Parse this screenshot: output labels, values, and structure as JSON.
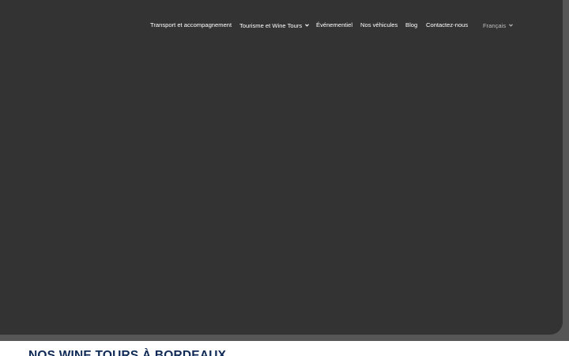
{
  "nav": {
    "items": [
      {
        "label": "Transport et accompagnement"
      },
      {
        "label": "Tourisme et Wine Tours"
      },
      {
        "label": "Événementiel"
      },
      {
        "label": "Nos véhicules"
      },
      {
        "label": "Blog"
      },
      {
        "label": "Contactez-nous"
      }
    ],
    "language": "Français"
  },
  "section": {
    "heading": "NOS WINE TOURS À BORDEAUX"
  },
  "icons": {
    "dropdown": "chevron-down-icon"
  },
  "colors": {
    "hero_background": "#333333",
    "band_background": "#565656",
    "heading": "#0f2a56",
    "nav_text": "#ffffff"
  }
}
